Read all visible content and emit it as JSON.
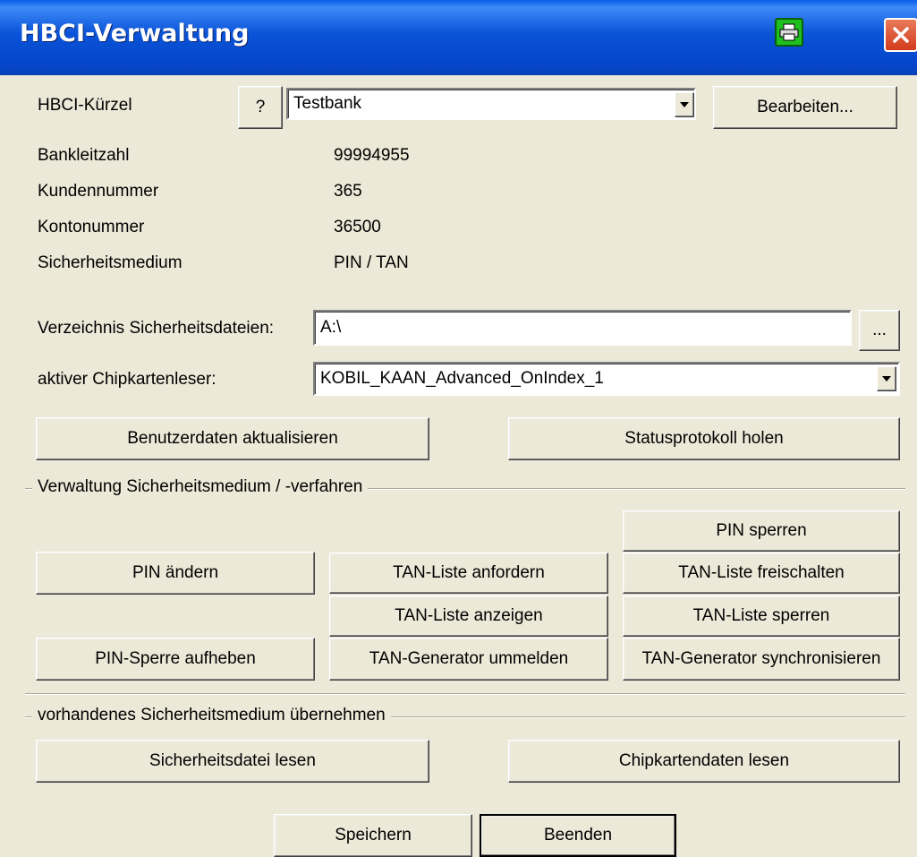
{
  "window": {
    "title": "HBCI-Verwaltung"
  },
  "hbci": {
    "kuerzel_label": "HBCI-Kürzel",
    "help_label": "?",
    "kuerzel_value": "Testbank",
    "edit_label": "Bearbeiten..."
  },
  "info": [
    {
      "label": "Bankleitzahl",
      "value": "99994955"
    },
    {
      "label": "Kundennummer",
      "value": "365"
    },
    {
      "label": "Kontonummer",
      "value": "36500"
    },
    {
      "label": "Sicherheitsmedium",
      "value": "PIN / TAN"
    }
  ],
  "directory": {
    "label": "Verzeichnis Sicherheitsdateien:",
    "value": "A:\\",
    "browse_label": "..."
  },
  "reader": {
    "label": "aktiver Chipkartenleser:",
    "value": "KOBIL_KAAN_Advanced_OnIndex_1"
  },
  "actions": {
    "update_user": "Benutzerdaten aktualisieren",
    "status_log": "Statusprotokoll holen"
  },
  "group_manage": {
    "title": "Verwaltung Sicherheitsmedium / -verfahren",
    "pin_change": "PIN ändern",
    "pin_unlock": "PIN-Sperre aufheben",
    "tan_request": "TAN-Liste anfordern",
    "tan_show": "TAN-Liste anzeigen",
    "tan_gen_unreg": "TAN-Generator ummelden",
    "pin_lock": "PIN sperren",
    "tan_activate": "TAN-Liste freischalten",
    "tan_lock": "TAN-Liste sperren",
    "tan_gen_sync": "TAN-Generator synchronisieren"
  },
  "group_import": {
    "title": "vorhandenes Sicherheitsmedium übernehmen",
    "read_file": "Sicherheitsdatei lesen",
    "read_card": "Chipkartendaten lesen"
  },
  "footer": {
    "save": "Speichern",
    "close": "Beenden"
  },
  "colors": {
    "titlebar": "#0A53D8",
    "face": "#ECE9D8",
    "close": "#D33C1C",
    "print": "#1FBF1F"
  }
}
